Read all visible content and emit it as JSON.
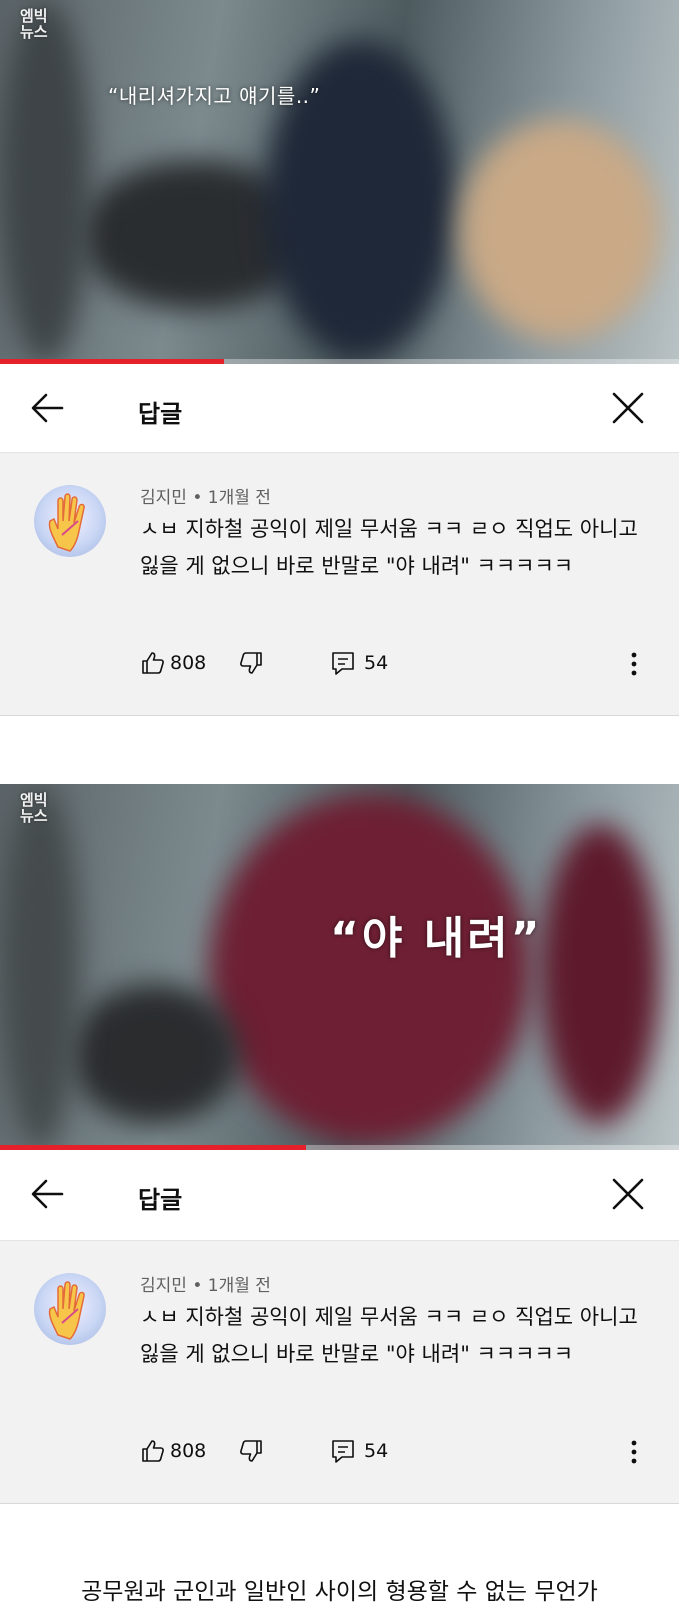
{
  "screenshots": [
    {
      "video": {
        "watermark": "엠빅\n뉴스",
        "subtitle": "“내리셔가지고 얘기를..”",
        "progress": 0.33
      },
      "reply_header": {
        "title": "답글"
      },
      "comment": {
        "author": "김지민",
        "separator": " • ",
        "time": "1개월 전",
        "text": "ㅅㅂ 지하철 공익이 제일 무서움 ㅋㅋ ㄹㅇ 직업도 아니고 잃을 게 없으니 바로 반말로 \"야 내려\" ㅋㅋㅋㅋㅋ",
        "likes": "808",
        "replies": "54"
      }
    },
    {
      "video": {
        "watermark": "엠빅\n뉴스",
        "subtitle": "“야 내려”",
        "progress": 0.45
      },
      "reply_header": {
        "title": "답글"
      },
      "comment": {
        "author": "김지민",
        "separator": " • ",
        "time": "1개월 전",
        "text": "ㅅㅂ 지하철 공익이 제일 무서움 ㅋㅋ ㄹㅇ 직업도 아니고 잃을 게 없으니 바로 반말로 \"야 내려\" ㅋㅋㅋㅋㅋ",
        "likes": "808",
        "replies": "54"
      }
    }
  ],
  "caption": "공무원과 군인과 일반인 사이의 형용할 수 없는 무언가",
  "icons": [
    "arrow-left-icon",
    "close-icon",
    "thumb-up-icon",
    "thumb-down-icon",
    "reply-icon",
    "more-vert-icon"
  ],
  "colors": {
    "progress": "#e6202a",
    "comment_bg": "#f2f2f2",
    "meta_text": "#606060"
  }
}
